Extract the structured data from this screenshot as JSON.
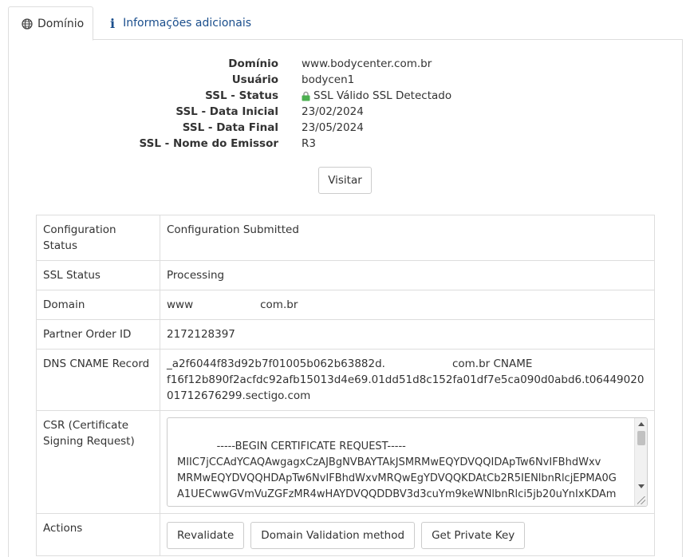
{
  "tabs": [
    {
      "label": "Domínio",
      "icon": "globe-icon",
      "active": true
    },
    {
      "label": "Informações adicionais",
      "icon": "info-icon",
      "active": false
    }
  ],
  "domain_info": {
    "rows": [
      {
        "label": "Domínio",
        "value": "www.bodycenter.com.br"
      },
      {
        "label": "Usuário",
        "value": "bodycen1"
      },
      {
        "label": "SSL - Status",
        "value": "SSL Válido SSL Detectado",
        "icon": "lock-icon"
      },
      {
        "label": "SSL - Data Inicial",
        "value": "23/02/2024"
      },
      {
        "label": "SSL - Data Final",
        "value": "23/05/2024"
      },
      {
        "label": "SSL - Nome do Emissor",
        "value": "R3"
      }
    ],
    "visit_label": "Visitar"
  },
  "details": {
    "config_status_label": "Configuration Status",
    "config_status_value": "Configuration Submitted",
    "ssl_status_label": "SSL Status",
    "ssl_status_value": "Processing",
    "domain_label": "Domain",
    "domain_prefix": "www",
    "domain_suffix": "com.br",
    "partner_order_label": "Partner Order ID",
    "partner_order_value": "2172128397",
    "dns_cname_label": "DNS CNAME Record",
    "dns_cname_prefix": "_a2f6044f83d92b7f01005b062b63882d.",
    "dns_cname_suffix": "com.br CNAME",
    "dns_cname_target": "f16f12b890f2acfdc92afb15013d4e69.01dd51d8c152fa01df7e5ca090d0abd6.t0644902001712676299.sectigo.com",
    "csr_label": "CSR (Certificate Signing Request)",
    "csr_value": "-----BEGIN CERTIFICATE REQUEST-----\nMIIC7jCCAdYCAQAwgagxCzAJBgNVBAYTAkJSMRMwEQYDVQQIDApTw6NvIFBhdWxv\nMRMwEQYDVQQHDApTw6NvIFBhdWxvMRQwEgYDVQQKDAtCb2R5IENlbnRlcjEPMA0G\nA1UECwwGVmVuZGFzMR4wHAYDVQQDDBV3d3cuYm9keWNlbnRlci5jb20uYnIxKDAm",
    "actions_label": "Actions",
    "actions": [
      "Revalidate",
      "Domain Validation method",
      "Get Private Key"
    ]
  }
}
